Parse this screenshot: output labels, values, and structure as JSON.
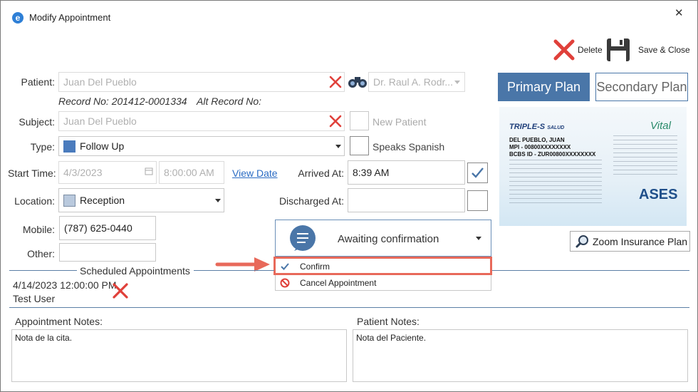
{
  "window": {
    "title": "Modify Appointment",
    "close_glyph": "✕"
  },
  "toolbar": {
    "delete_label": "Delete",
    "save_close_label": "Save & Close"
  },
  "patient": {
    "label": "Patient:",
    "value": "Juan Del Pueblo",
    "record_no": "Record No: 201412-0001334",
    "alt_record_no": "Alt Record No:",
    "doctor": "Dr. Raul A. Rodr..."
  },
  "subject": {
    "label": "Subject:",
    "value": "Juan Del Pueblo",
    "new_patient_label": "New Patient"
  },
  "type": {
    "label": "Type:",
    "value": "Follow Up",
    "color": "#4a7bbd",
    "speaks_spanish_label": "Speaks Spanish"
  },
  "start_time": {
    "label": "Start Time:",
    "date": "4/3/2023",
    "time": "8:00:00 AM",
    "view_date_link": "View Date"
  },
  "arrived": {
    "label": "Arrived At:",
    "value": "8:39 AM",
    "checked": true
  },
  "location": {
    "label": "Location:",
    "value": "Reception",
    "color": "#b9c9dd"
  },
  "discharged": {
    "label": "Discharged At:",
    "value": "",
    "checked": false
  },
  "mobile": {
    "label": "Mobile:",
    "value": "(787) 625-0440"
  },
  "other": {
    "label": "Other:",
    "value": ""
  },
  "status": {
    "selected": "Awaiting confirmation",
    "options": [
      {
        "label": "Confirm",
        "icon": "checkmark-icon"
      },
      {
        "label": "Cancel Appointment",
        "icon": "cancel-icon"
      }
    ]
  },
  "plans": {
    "primary_label": "Primary Plan",
    "secondary_label": "Secondary Plan",
    "zoom_label": "Zoom Insurance Plan"
  },
  "insurance_card": {
    "brand": "TRIPLE-S",
    "brand_sub": "SALUD",
    "name": "DEL PUEBLO, JUAN",
    "mpi": "MPI - 00800XXXXXXXX",
    "bcbs": "BCBS ID - ZUR00800XXXXXXXX",
    "vital": "Vital",
    "ases": "ASES"
  },
  "scheduled": {
    "title": "Scheduled Appointments",
    "entries": [
      {
        "datetime": "4/14/2023 12:00:00 PM",
        "user": "Test User"
      }
    ]
  },
  "notes": {
    "appointment_label": "Appointment Notes:",
    "appointment_value": "Nota de la cita.",
    "patient_label": "Patient Notes:",
    "patient_value": "Nota del Paciente."
  },
  "colors": {
    "accent": "#4a76a8",
    "danger": "#e0403a",
    "highlight": "#e8695a"
  }
}
